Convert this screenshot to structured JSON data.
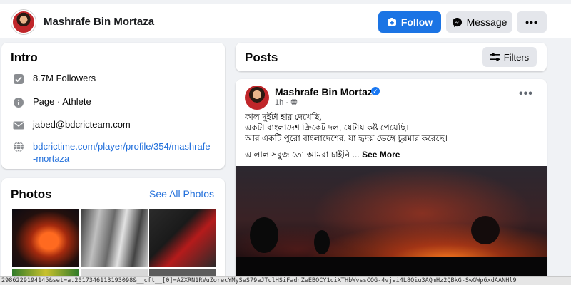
{
  "header": {
    "name": "Mashrafe Bin Mortaza",
    "follow_label": "Follow",
    "message_label": "Message",
    "more_label": "•••"
  },
  "intro": {
    "title": "Intro",
    "followers": "8.7M Followers",
    "category": "Page · Athlete",
    "email": "jabed@bdcricteam.com",
    "website_line1": "bdcrictime.com/player/profile/354/mashrafe",
    "website_line2": "-mortaza"
  },
  "photos": {
    "title": "Photos",
    "see_all": "See All Photos"
  },
  "posts": {
    "title": "Posts",
    "filters_label": "Filters"
  },
  "post": {
    "author": "Mashrafe Bin Mortaza",
    "time": "1h · ",
    "lines": [
      "কাল দুইটা হার দেখেছি,",
      "একটা বাংলাদেশ ক্রিকেট দল, যেটায় কষ্ট পেয়েছি।",
      "আর একটি পুরো বাংলাদেশের, যা হৃদয় ভেঙ্গে চুরমার করেছে।"
    ],
    "last_line": "এ লাল সবুজ তো আমরা চাইনি ...",
    "see_more": "See More"
  },
  "status_bar": {
    "url": "2986229194145&set=a.2017346113193098&__cft__[0]=AZXRN1RVuZorecYMySeS79aJTulHSiFadnZeEBOCY1ciXTHbWvssCOG-4vjai4L8Qiu3AQmHz2QBkG-SwGWp6xdAANHl9"
  },
  "colors": {
    "accent": "#1b74e4",
    "link": "#216fdb",
    "page_bg": "#f0f2f5"
  }
}
